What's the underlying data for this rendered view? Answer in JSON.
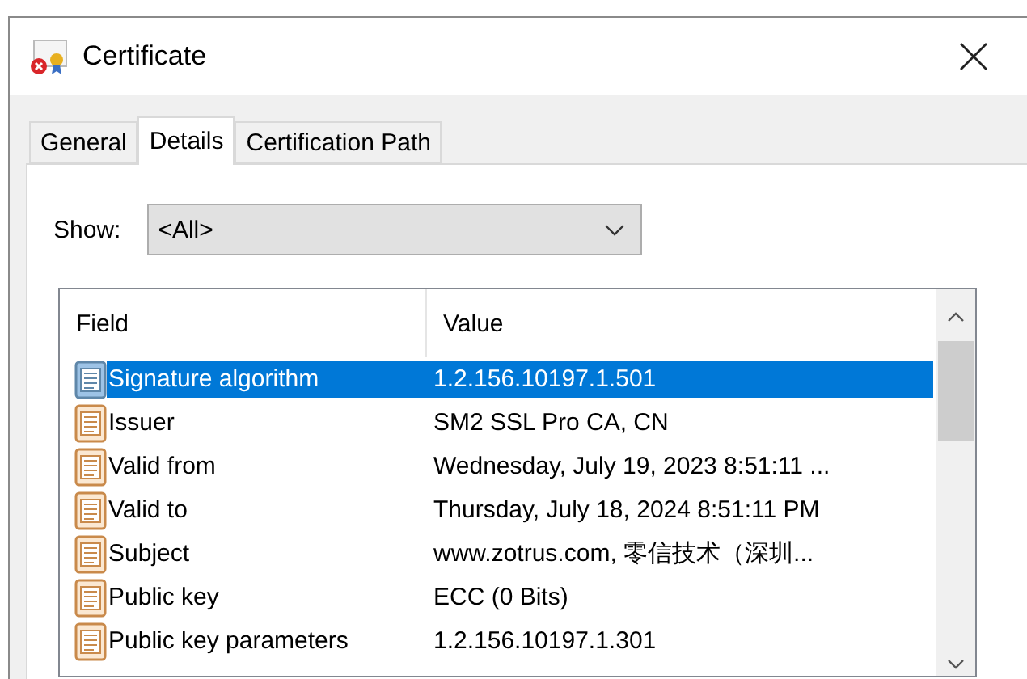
{
  "window": {
    "title": "Certificate"
  },
  "tabs": [
    {
      "label": "General",
      "selected": false
    },
    {
      "label": "Details",
      "selected": true
    },
    {
      "label": "Certification Path",
      "selected": false
    }
  ],
  "show": {
    "label": "Show:",
    "value": "<All>"
  },
  "table": {
    "columns": [
      "Field",
      "Value"
    ],
    "rows": [
      {
        "field": "Signature algorithm",
        "value": "1.2.156.10197.1.501",
        "selected": true
      },
      {
        "field": "Issuer",
        "value": "SM2 SSL Pro CA, CN",
        "selected": false
      },
      {
        "field": "Valid from",
        "value": "Wednesday, July 19, 2023 8:51:11 ...",
        "selected": false
      },
      {
        "field": "Valid to",
        "value": "Thursday, July 18, 2024 8:51:11 PM",
        "selected": false
      },
      {
        "field": "Subject",
        "value": "www.zotrus.com, 零信技术（深圳...",
        "selected": false
      },
      {
        "field": "Public key",
        "value": "ECC (0 Bits)",
        "selected": false
      },
      {
        "field": "Public key parameters",
        "value": "1.2.156.10197.1.301",
        "selected": false
      }
    ]
  }
}
